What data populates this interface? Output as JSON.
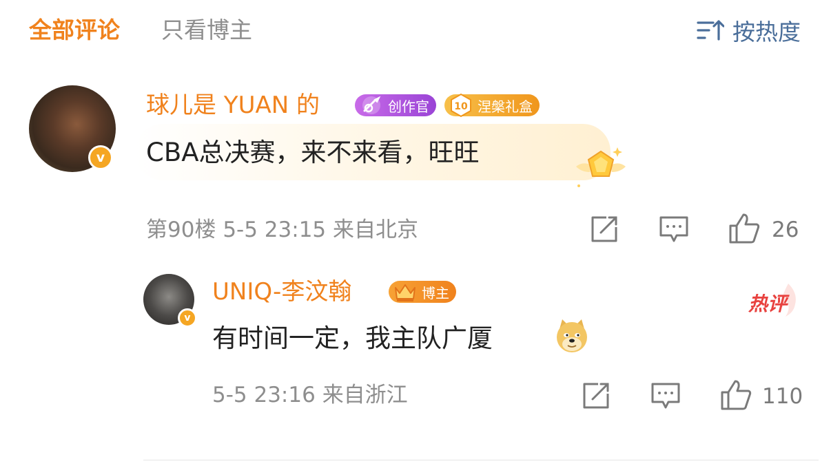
{
  "header": {
    "tabs": [
      {
        "label": "全部评论",
        "active": true
      },
      {
        "label": "只看博主",
        "active": false
      }
    ],
    "sort_label": "按热度"
  },
  "comment": {
    "username": "球儿是 YUAN 的",
    "badges": [
      {
        "label": "创作官",
        "color": "#a855dd",
        "icon": "rocket-icon"
      },
      {
        "label": "涅槃礼盒",
        "color": "#f0a22a",
        "icon": "level-10-icon",
        "level": "10"
      }
    ],
    "verified": true,
    "text": "CBA总决赛，来不来看，旺旺",
    "floor": "第90楼",
    "date": "5-5 23:15",
    "location": "来自北京",
    "like_count": "26"
  },
  "reply": {
    "username": "UNIQ-李汶翰",
    "badges": [
      {
        "label": "博主",
        "color": "#f0821d",
        "icon": "crown-icon"
      }
    ],
    "verified": true,
    "hot_label": "热评",
    "text": "有时间一定，我主队广厦",
    "emoji": "doge-emoji",
    "date": "5-5 23:16",
    "location": "来自浙江",
    "like_count": "110"
  },
  "colors": {
    "accent": "#f0821d",
    "inactive_tab": "#8e8e8e",
    "sort": "#4a6e9a",
    "hot": "#e8423f"
  }
}
